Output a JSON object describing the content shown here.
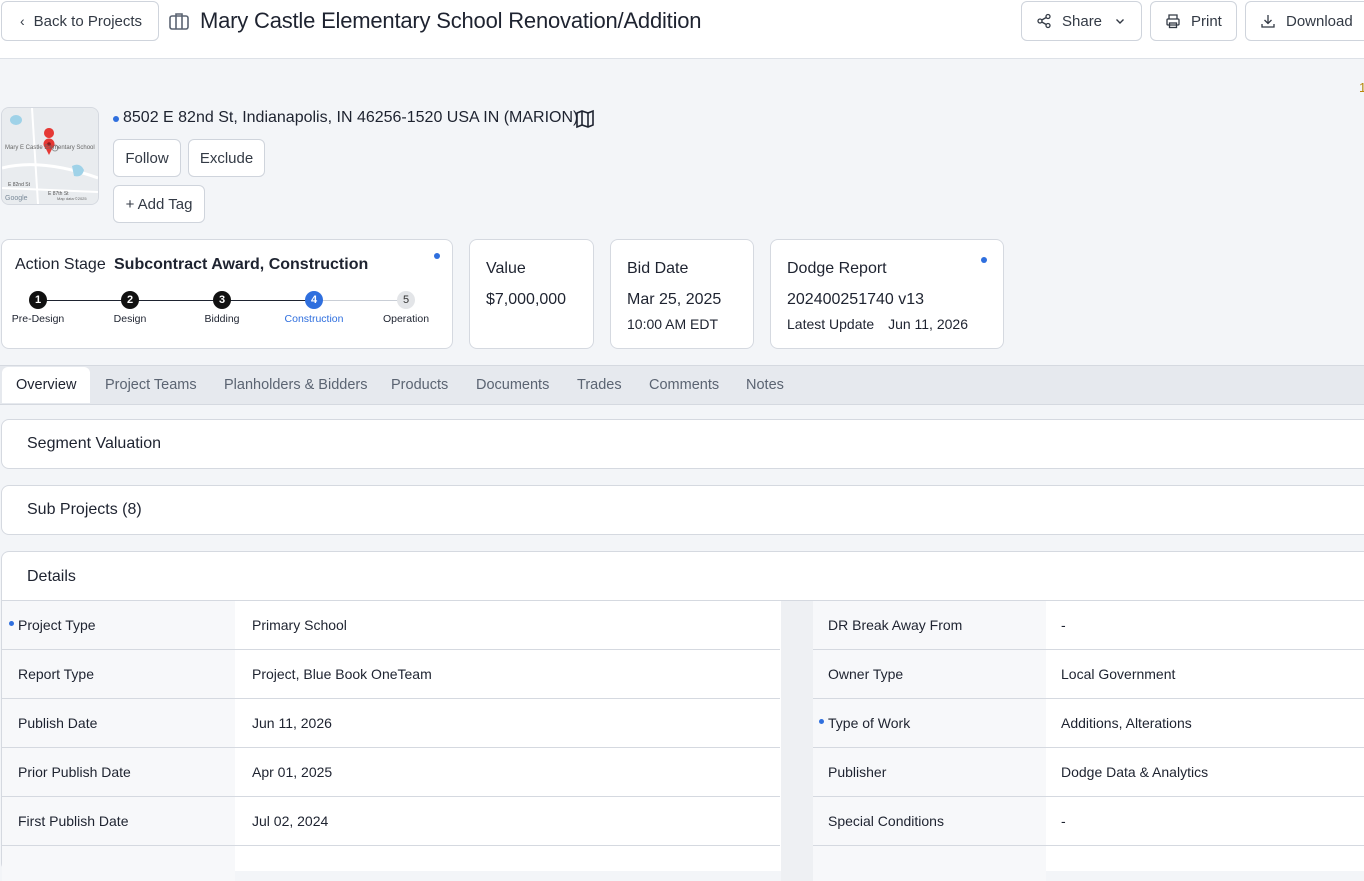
{
  "header": {
    "back_label": "Back to Projects",
    "title": "Mary Castle Elementary School Renovation/Addition",
    "share_label": "Share",
    "print_label": "Print",
    "download_label": "Download",
    "edge_char": "1"
  },
  "location": {
    "address": "8502 E 82nd St, Indianapolis, IN 46256-1520 USA IN (MARION)",
    "map_label": "Mary E Castle Elementary School",
    "map_street": "E 82nd St",
    "map_street2": "E 87th St",
    "map_brand": "Google",
    "map_credit": "Map data ©2025"
  },
  "actions": {
    "follow_label": "Follow",
    "exclude_label": "Exclude",
    "add_tag_label": "+ Add Tag"
  },
  "stage": {
    "label": "Action Stage",
    "value": "Subcontract Award, Construction",
    "steps": [
      {
        "num": "1",
        "label": "Pre-Design"
      },
      {
        "num": "2",
        "label": "Design"
      },
      {
        "num": "3",
        "label": "Bidding"
      },
      {
        "num": "4",
        "label": "Construction"
      },
      {
        "num": "5",
        "label": "Operation"
      }
    ],
    "current_step": 4
  },
  "value_card": {
    "heading": "Value",
    "value": "$7,000,000"
  },
  "bid_card": {
    "heading": "Bid Date",
    "date": "Mar 25, 2025",
    "time": "10:00 AM EDT"
  },
  "dodge_card": {
    "heading": "Dodge Report",
    "report": "202400251740 v13",
    "update_label": "Latest Update",
    "update_date": "Jun 11, 2026"
  },
  "tabs": [
    "Overview",
    "Project Teams",
    "Planholders & Bidders",
    "Products",
    "Documents",
    "Trades",
    "Comments",
    "Notes"
  ],
  "sections": {
    "segment_valuation": "Segment Valuation",
    "sub_projects": "Sub Projects (8)",
    "details": "Details"
  },
  "details": {
    "left": [
      {
        "label": "Project Type",
        "value": "Primary School"
      },
      {
        "label": "Report Type",
        "value": "Project, Blue Book OneTeam"
      },
      {
        "label": "Publish Date",
        "value": "Jun 11, 2026"
      },
      {
        "label": "Prior Publish Date",
        "value": "Apr 01, 2025"
      },
      {
        "label": "First Publish Date",
        "value": "Jul 02, 2024"
      }
    ],
    "right": [
      {
        "label": "DR Break Away From",
        "value": "-"
      },
      {
        "label": "Owner Type",
        "value": "Local Government"
      },
      {
        "label": "Type of Work",
        "value": "Additions, Alterations"
      },
      {
        "label": "Publisher",
        "value": "Dodge Data & Analytics"
      },
      {
        "label": "Special Conditions",
        "value": "-"
      }
    ]
  },
  "colors": {
    "accent": "#2f6fde",
    "page_bg": "#f3f5f8",
    "border": "#d5d9e0"
  }
}
